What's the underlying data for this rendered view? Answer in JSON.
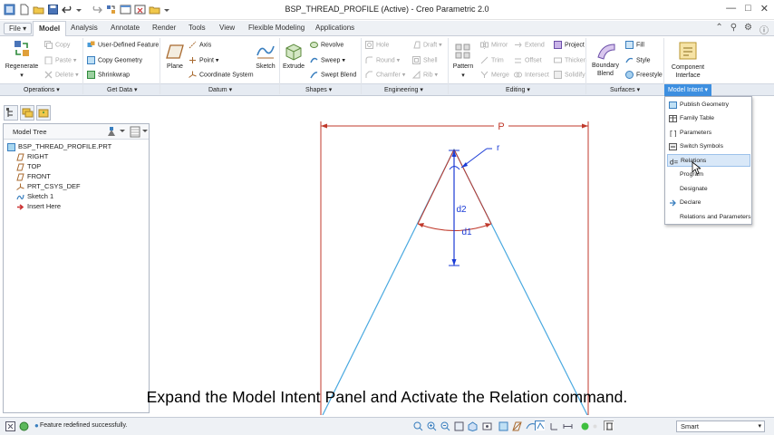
{
  "window": {
    "title": "BSP_THREAD_PROFILE (Active) - Creo Parametric 2.0"
  },
  "tabs": {
    "file": "File",
    "items": [
      "Model",
      "Analysis",
      "Annotate",
      "Render",
      "Tools",
      "View",
      "Flexible Modeling",
      "Applications"
    ],
    "active": "Model"
  },
  "ribbon": {
    "regenerate": "Regenerate",
    "copy": "Copy",
    "paste": "Paste",
    "delete": "Delete",
    "user_defined_feature": "User-Defined Feature",
    "copy_geometry": "Copy Geometry",
    "shrinkwrap": "Shrinkwrap",
    "plane": "Plane",
    "axis": "Axis",
    "point": "Point",
    "coordinate_system": "Coordinate System",
    "sketch": "Sketch",
    "extrude": "Extrude",
    "revolve": "Revolve",
    "sweep": "Sweep",
    "swept_blend": "Swept Blend",
    "hole": "Hole",
    "round": "Round",
    "chamfer": "Chamfer",
    "draft": "Draft",
    "shell": "Shell",
    "rib": "Rib",
    "pattern": "Pattern",
    "mirror": "Mirror",
    "trim": "Trim",
    "merge": "Merge",
    "extend": "Extend",
    "offset": "Offset",
    "intersect": "Intersect",
    "project": "Project",
    "thicken": "Thicken",
    "solidify": "Solidify",
    "boundary_blend": "Boundary Blend",
    "fill": "Fill",
    "style": "Style",
    "freestyle": "Freestyle",
    "component_interface": "Component Interface"
  },
  "groups": [
    "Operations",
    "Get Data",
    "Datum",
    "Shapes",
    "Engineering",
    "Editing",
    "Surfaces",
    "Model Intent"
  ],
  "model_tree": {
    "header": "Model Tree",
    "root": "BSP_THREAD_PROFILE.PRT",
    "items": [
      "RIGHT",
      "TOP",
      "FRONT",
      "PRT_CSYS_DEF",
      "Sketch 1",
      "Insert Here"
    ]
  },
  "model_intent_menu": {
    "items": [
      "Publish Geometry",
      "Family Table",
      "Parameters",
      "Switch Symbols",
      "Relations",
      "Program",
      "Designate",
      "Declare",
      "Relations and Parameters"
    ],
    "highlighted": "Relations"
  },
  "sketch": {
    "dim_p": "P",
    "dim_r": "r",
    "dim_d2": "d2",
    "dim_d1": "d1"
  },
  "caption": "Expand the Model Intent Panel and Activate the Relation command.",
  "status": {
    "message": "Feature redefined successfully.",
    "filter": "Smart"
  },
  "colors": {
    "accent": "#3d8fe0",
    "sketch_line": "#4aa9e0",
    "dimension": "#c0392b",
    "dim_blue": "#1a3bd6"
  }
}
